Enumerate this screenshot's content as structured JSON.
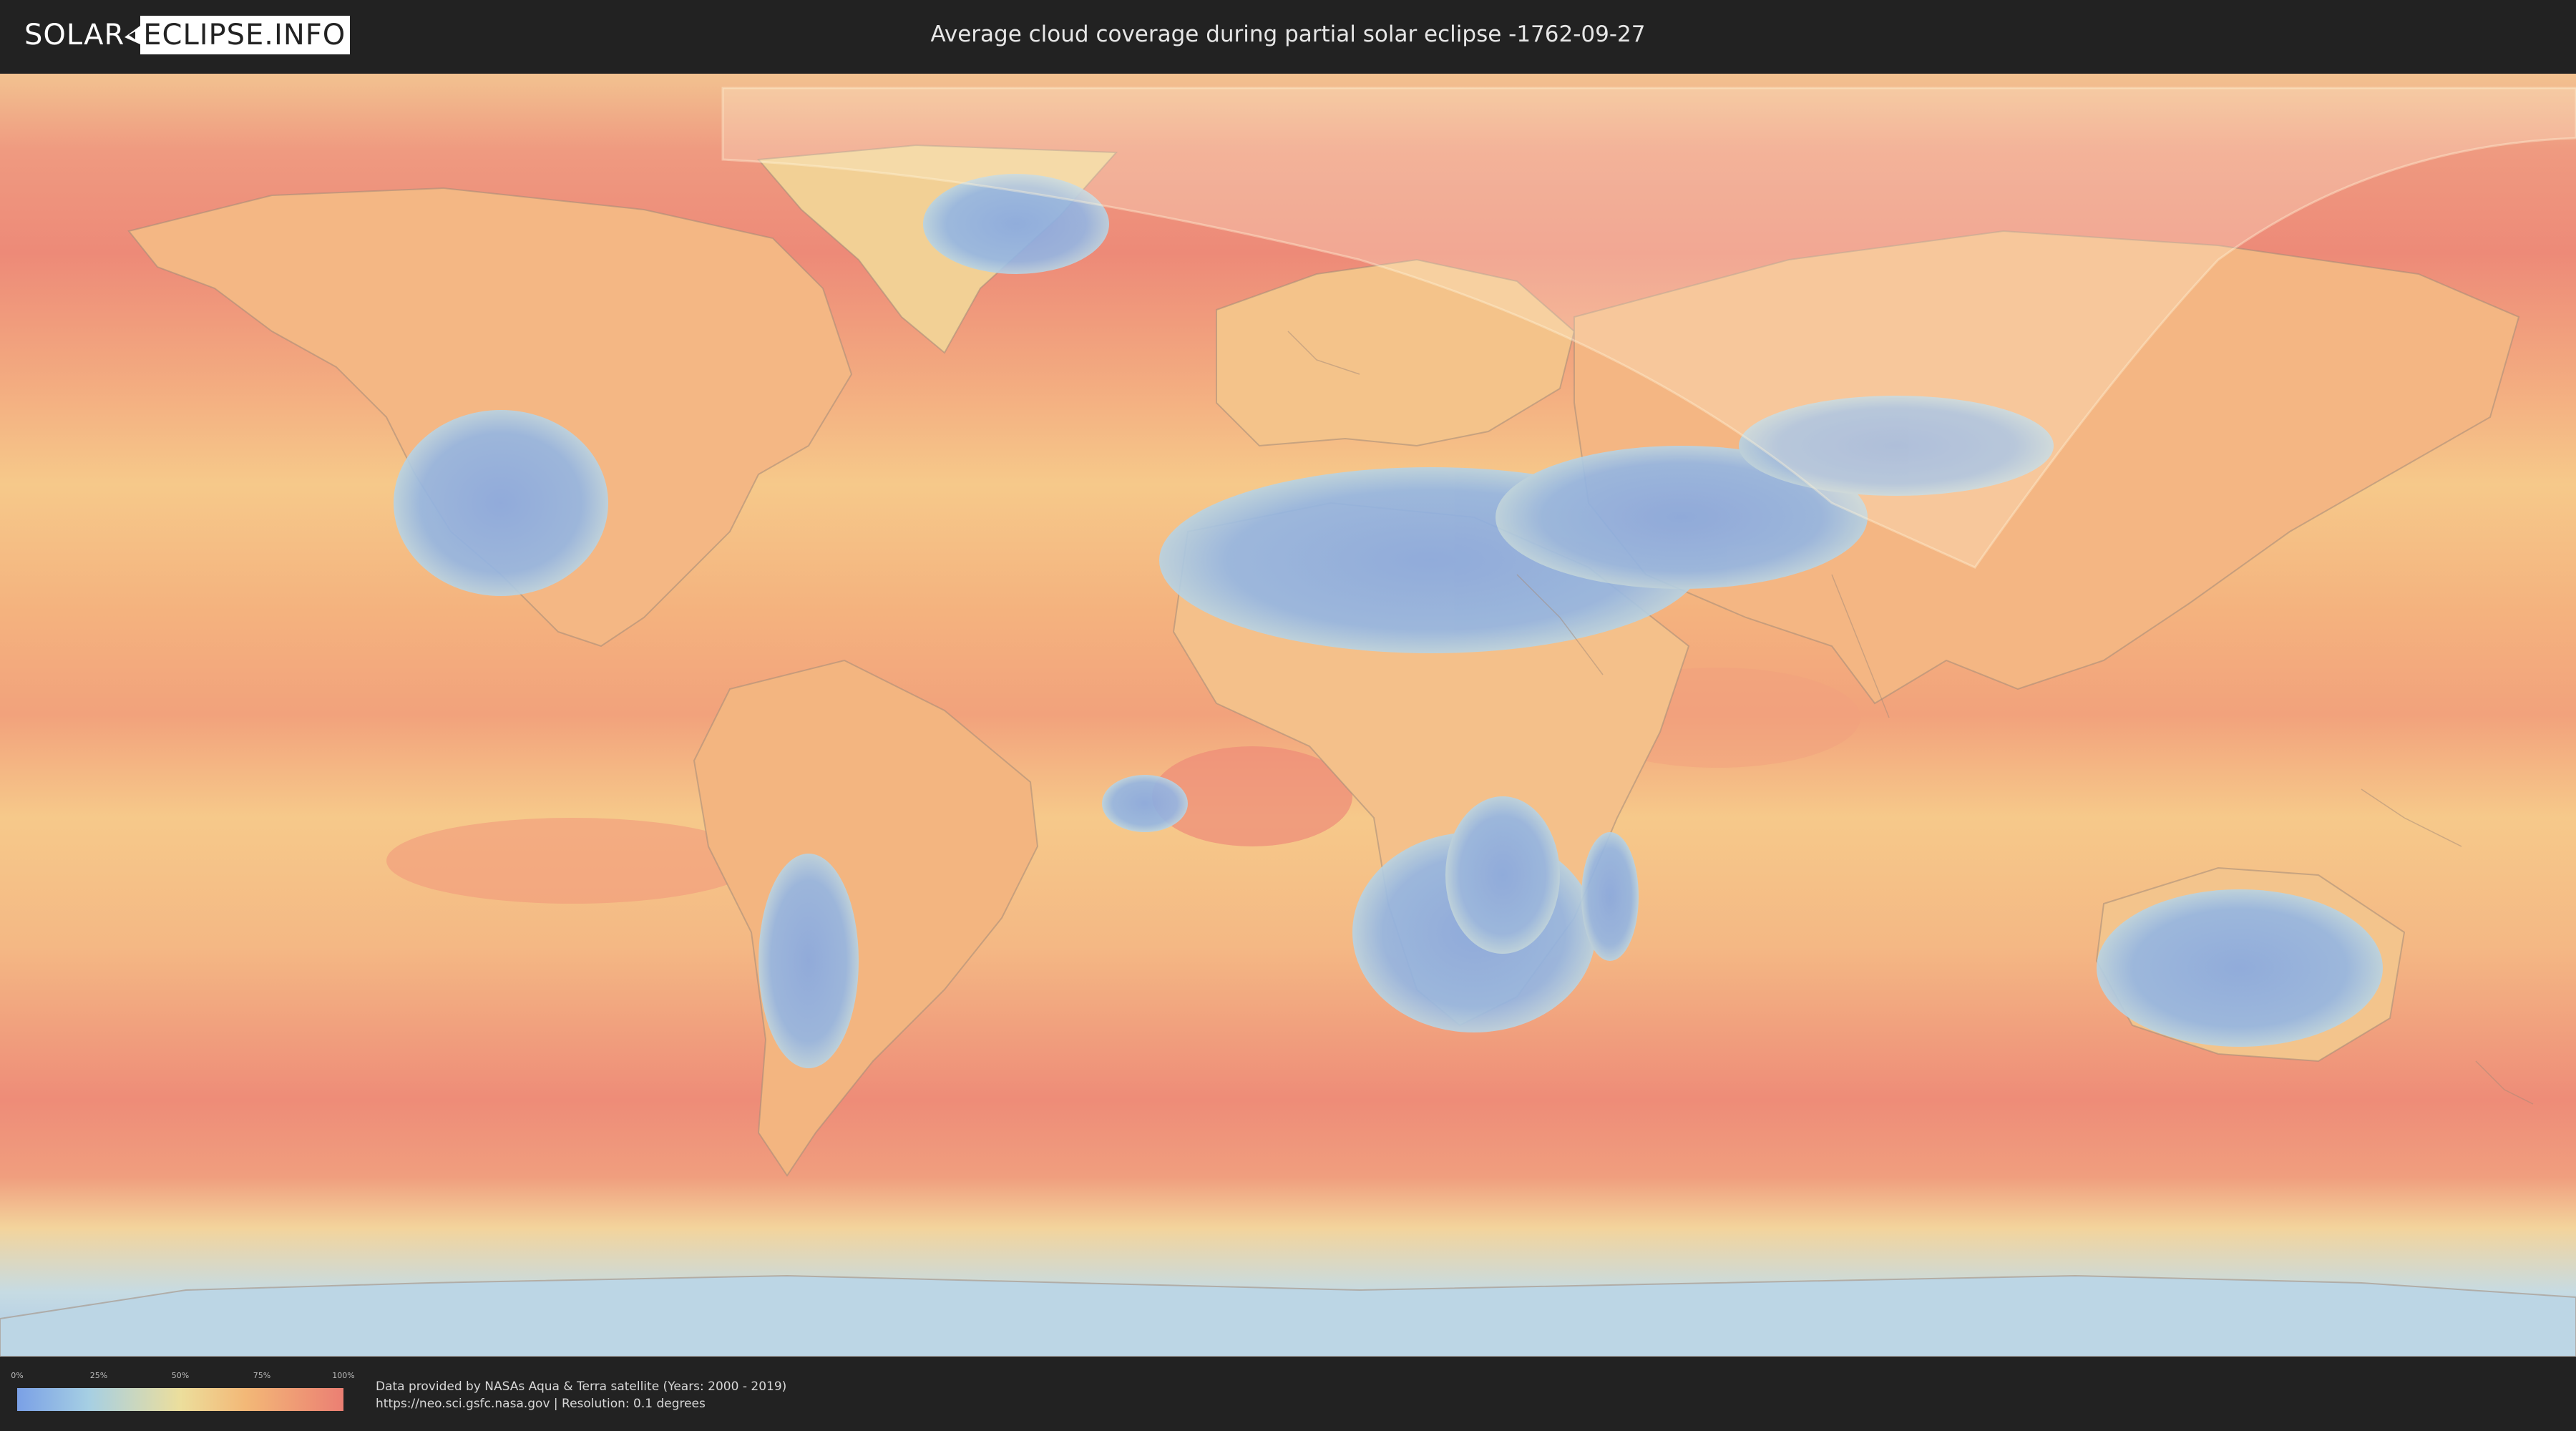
{
  "header": {
    "logo": {
      "part1": "SOLAR",
      "part2": "ECLIPSE.INFO"
    },
    "title": "Average cloud coverage during partial solar eclipse -1762-09-27"
  },
  "map": {
    "kind": "world cloud-coverage map, equirectangular",
    "colors": {
      "ocean_cloudy": "#ee8a78",
      "ocean_mid": "#f5c886",
      "clear": "#86a9e3",
      "clear_light": "#b7d3e6",
      "border": "#a38a78",
      "eclipse_overlay": "#fff6dc"
    }
  },
  "legend": {
    "ticks": [
      "0%",
      "25%",
      "50%",
      "75%",
      "100%"
    ],
    "colors": [
      "#7aa0e6",
      "#a6cfe3",
      "#ecde9c",
      "#f3b877",
      "#eb7f73"
    ]
  },
  "credit": {
    "line1": "Data provided by NASAs Aqua & Terra satellite (Years: 2000 - 2019)",
    "line2": "https://neo.sci.gsfc.nasa.gov | Resolution: 0.1 degrees"
  }
}
